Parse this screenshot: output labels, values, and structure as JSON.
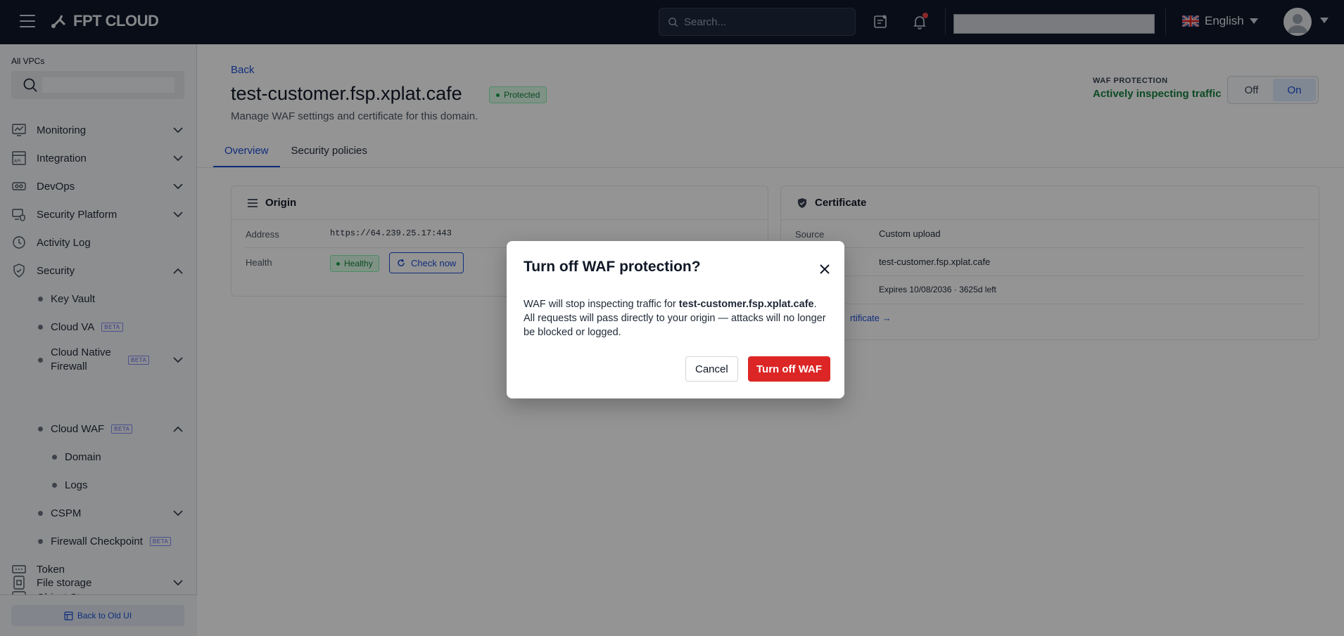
{
  "topbar": {
    "logo_text": "FPT CLOUD",
    "search_placeholder": "Search...",
    "language": "English"
  },
  "sidebar": {
    "vpc_label": "All VPCs",
    "items": [
      {
        "label": "Monitoring",
        "icon": "monitoring-icon"
      },
      {
        "label": "Integration",
        "icon": "api-icon"
      },
      {
        "label": "DevOps",
        "icon": "devops-icon"
      },
      {
        "label": "Security Platform",
        "icon": "security-platform-icon"
      },
      {
        "label": "Activity Log",
        "icon": "history-icon"
      },
      {
        "label": "Security",
        "icon": "shield-icon"
      }
    ],
    "security_children": [
      {
        "label": "Key Vault"
      },
      {
        "label": "Cloud VA",
        "badge": "BETA"
      },
      {
        "label": "Cloud Native Firewall",
        "badge": "BETA"
      },
      {
        "label": "Cloud WAF",
        "badge": "BETA"
      },
      {
        "label": "Domain"
      },
      {
        "label": "Logs"
      },
      {
        "label": "CSPM"
      },
      {
        "label": "Firewall Checkpoint",
        "badge": "BETA"
      }
    ],
    "bottom_items": [
      {
        "label": "Token",
        "icon": "token-icon"
      },
      {
        "label": "Object Storage",
        "icon": "storage-icon"
      },
      {
        "label": "File storage",
        "icon": "file-storage-icon"
      }
    ],
    "back_old_ui": "Back to Old UI"
  },
  "main": {
    "back": "Back",
    "title": "test-customer.fsp.xplat.cafe",
    "status_badge": "Protected",
    "subtitle": "Manage WAF settings and certificate for this domain.",
    "waf_protection_label": "WAF PROTECTION",
    "waf_status": "Actively inspecting traffic",
    "toggle_off": "Off",
    "toggle_on": "On",
    "tabs": [
      {
        "label": "Overview"
      },
      {
        "label": "Security policies"
      }
    ],
    "origin": {
      "title": "Origin",
      "address_label": "Address",
      "address_value": "https://64.239.25.17:443",
      "health_label": "Health",
      "health_value": "Healthy",
      "check_now": "Check now"
    },
    "certificate": {
      "title": "Certificate",
      "source_label": "Source",
      "source_value": "Custom upload",
      "domain_value": "test-customer.fsp.xplat.cafe",
      "expires_value": "Expires 10/08/2036 · 3625d left",
      "link_partial": "rtificate →"
    }
  },
  "modal": {
    "title": "Turn off WAF protection?",
    "body_prefix": "WAF will stop inspecting traffic for ",
    "body_domain": "test-customer.fsp.xplat.cafe",
    "body_suffix": ". All requests will pass directly to your origin — attacks will no longer be blocked or logged.",
    "cancel": "Cancel",
    "confirm": "Turn off WAF"
  },
  "colors": {
    "topbar_bg": "#0f172a",
    "accent": "#1d4ed8",
    "success": "#15803d",
    "danger": "#dc2626"
  }
}
